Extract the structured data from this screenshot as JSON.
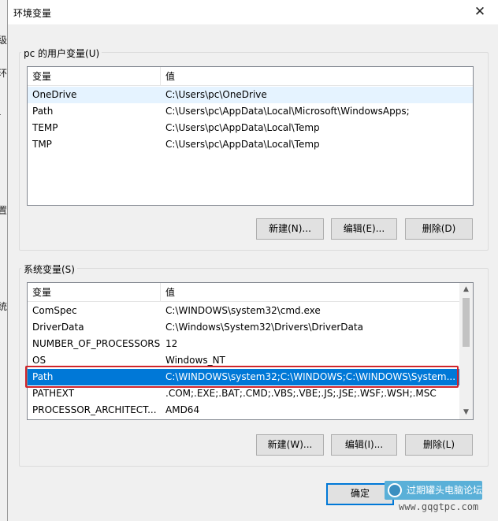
{
  "window": {
    "title": "环境变量"
  },
  "background_fragments": [
    "级",
    "环",
    "-",
    "置",
    "统"
  ],
  "user_vars": {
    "group_label": "pc 的用户变量(U)",
    "columns": [
      "变量",
      "值"
    ],
    "rows": [
      {
        "name": "OneDrive",
        "value": "C:\\Users\\pc\\OneDrive"
      },
      {
        "name": "Path",
        "value": "C:\\Users\\pc\\AppData\\Local\\Microsoft\\WindowsApps;"
      },
      {
        "name": "TEMP",
        "value": "C:\\Users\\pc\\AppData\\Local\\Temp"
      },
      {
        "name": "TMP",
        "value": "C:\\Users\\pc\\AppData\\Local\\Temp"
      }
    ],
    "buttons": {
      "new": "新建(N)...",
      "edit": "编辑(E)...",
      "delete": "删除(D)"
    }
  },
  "system_vars": {
    "group_label": "系统变量(S)",
    "columns": [
      "变量",
      "值"
    ],
    "rows": [
      {
        "name": "ComSpec",
        "value": "C:\\WINDOWS\\system32\\cmd.exe"
      },
      {
        "name": "DriverData",
        "value": "C:\\Windows\\System32\\Drivers\\DriverData"
      },
      {
        "name": "NUMBER_OF_PROCESSORS",
        "value": "12"
      },
      {
        "name": "OS",
        "value": "Windows_NT"
      },
      {
        "name": "Path",
        "value": "C:\\WINDOWS\\system32;C:\\WINDOWS;C:\\WINDOWS\\System..."
      },
      {
        "name": "PATHEXT",
        "value": ".COM;.EXE;.BAT;.CMD;.VBS;.VBE;.JS;.JSE;.WSF;.WSH;.MSC"
      },
      {
        "name": "PROCESSOR_ARCHITECT...",
        "value": "AMD64"
      }
    ],
    "selected_row": 4,
    "buttons": {
      "new": "新建(W)...",
      "edit": "编辑(I)...",
      "delete": "删除(L)"
    }
  },
  "footer": {
    "ok": "确定"
  },
  "watermark": {
    "brand": "过期罐头电脑论坛",
    "url": "www.gqgtpc.com"
  },
  "colors": {
    "selection": "#0078d7",
    "highlight_box": "#d0242b",
    "hover": "#e5f3ff"
  }
}
